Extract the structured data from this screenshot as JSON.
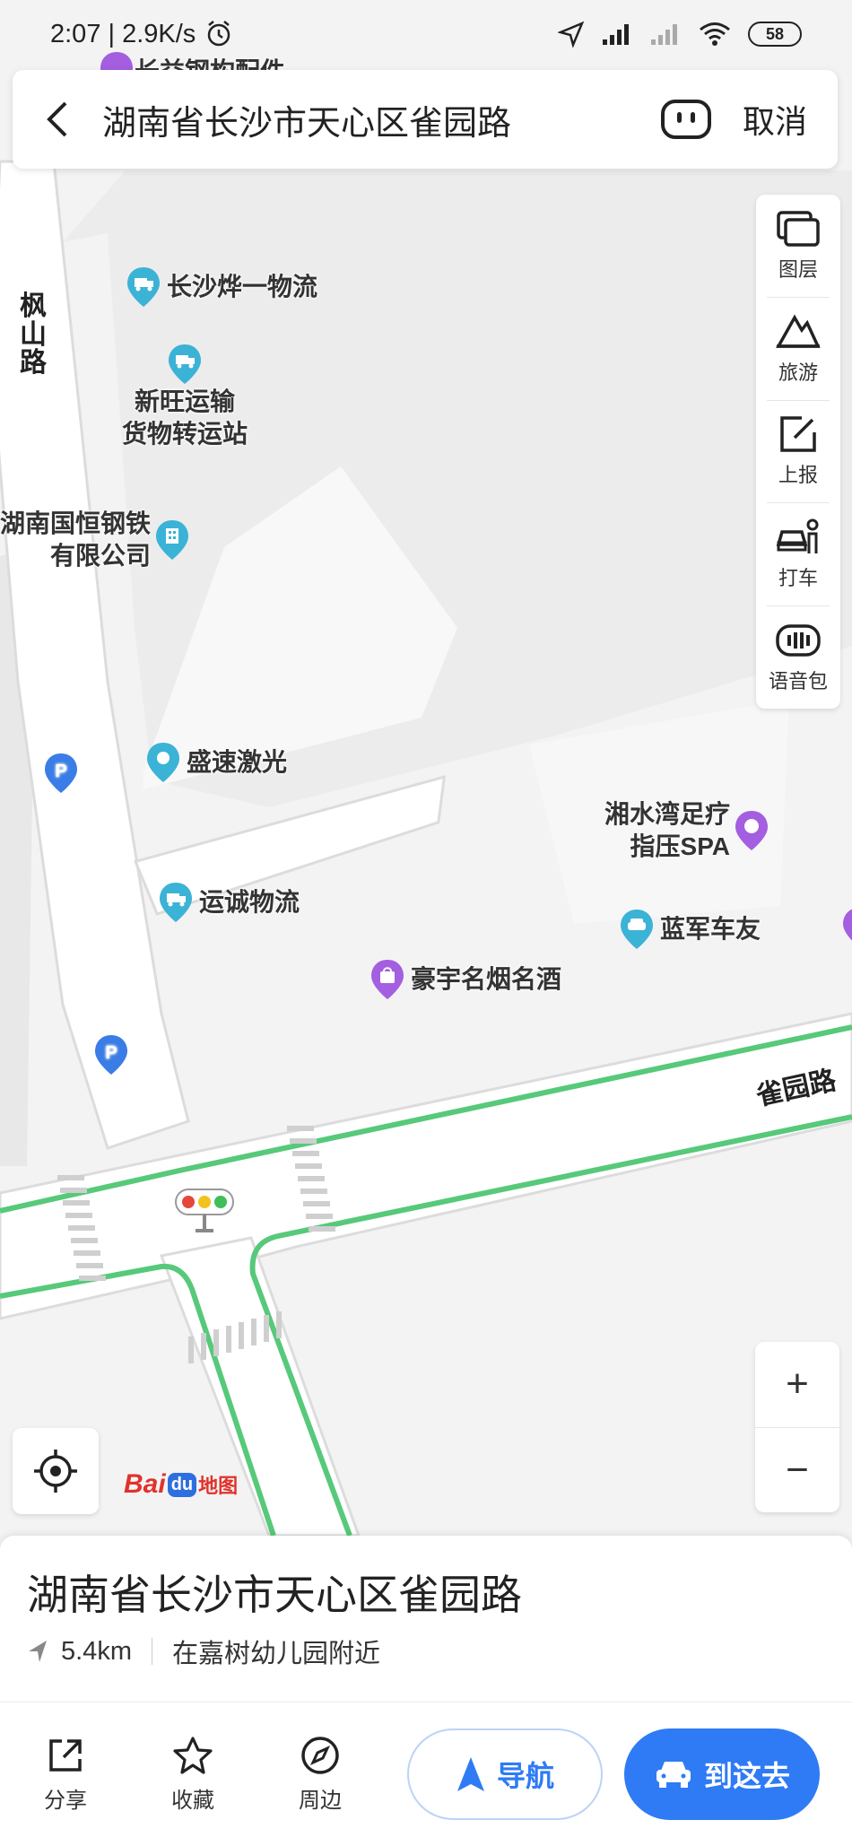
{
  "status_bar": {
    "time": "2:07 | 2.9K/s",
    "battery": "58"
  },
  "search": {
    "query": "湖南省长沙市天心区雀园路",
    "cancel_label": "取消"
  },
  "toolbar": {
    "items": [
      {
        "label": "图层",
        "icon": "layers-icon"
      },
      {
        "label": "旅游",
        "icon": "travel-icon"
      },
      {
        "label": "上报",
        "icon": "report-icon"
      },
      {
        "label": "打车",
        "icon": "taxi-icon"
      },
      {
        "label": "语音包",
        "icon": "voice-pack-icon"
      }
    ]
  },
  "map": {
    "top_partial_label": "长益钢构配件",
    "pois": [
      {
        "label": "长沙烨一物流",
        "type": "logistics",
        "color": "#3bb3d6"
      },
      {
        "label": "新旺运输\n货物转运站",
        "type": "logistics",
        "color": "#3bb3d6"
      },
      {
        "label": "湖南国恒钢铁\n有限公司",
        "type": "company",
        "color": "#3bb3d6"
      },
      {
        "label": "盛速激光",
        "type": "generic",
        "color": "#3bb3d6"
      },
      {
        "label": "运诚物流",
        "type": "logistics",
        "color": "#3bb3d6"
      },
      {
        "label": "湘水湾足疗\n指压SPA",
        "type": "spa",
        "color": "#a45ee0"
      },
      {
        "label": "蓝军车友",
        "type": "car",
        "color": "#3bb3d6"
      },
      {
        "label": "豪宇名烟名酒",
        "type": "shop",
        "color": "#a45ee0"
      }
    ],
    "roads": {
      "fengshan": "枫\n山\n路",
      "queyuan": "雀园路"
    },
    "parking_label": "P",
    "road_highlight_color": "#57c97a"
  },
  "logo": {
    "bai": "Bai",
    "du": "du",
    "map": "地图"
  },
  "zoom": {
    "in": "+",
    "out": "−"
  },
  "place": {
    "title": "湖南省长沙市天心区雀园路",
    "distance": "5.4km",
    "nearby": "在嘉树幼儿园附近"
  },
  "actions": {
    "share": "分享",
    "favorite": "收藏",
    "nearby": "周边",
    "navigate": "导航",
    "go_here": "到这去"
  },
  "colors": {
    "accent": "#2f7bf5",
    "purple_poi": "#a45ee0",
    "teal_poi": "#3bb3d6"
  }
}
